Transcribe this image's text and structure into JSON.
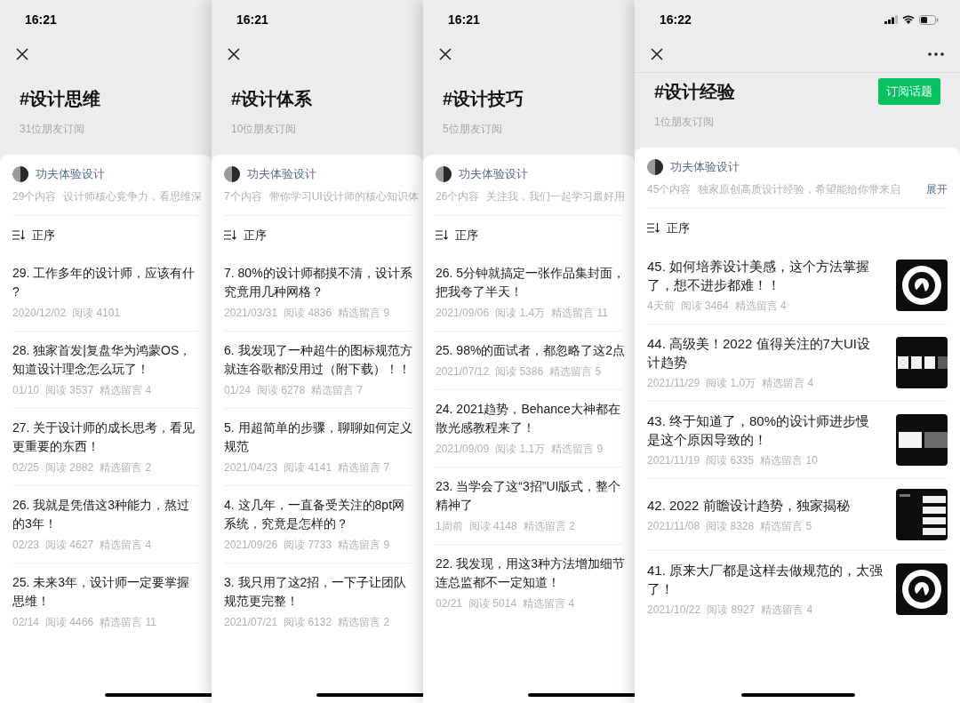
{
  "phones": [
    {
      "time": "16:21",
      "status_icons": false,
      "more_menu": false,
      "topic": "#设计思维",
      "subscribers": "31位朋友订阅",
      "author": "功夫体验设计",
      "intro": [
        "29个内容",
        "设计师核心竞争力，看思维深"
      ],
      "sort": "正序",
      "items": [
        {
          "title_lines": [
            "29. 工作多年的设计师，应该有什",
            "?"
          ],
          "meta": [
            "2020/12/02",
            "阅读 4101"
          ]
        },
        {
          "title_lines": [
            "28. 独家首发|复盘华为鸿蒙OS，",
            "知道设计理念怎么玩了！"
          ],
          "meta": [
            "01/10",
            "阅读 3537",
            "精选留言 4"
          ]
        },
        {
          "title_lines": [
            "27. 关于设计师的成长思考，看见",
            "更重要的东西！"
          ],
          "meta": [
            "02/25",
            "阅读 2882",
            "精选留言 2"
          ]
        },
        {
          "title_lines": [
            "26. 我就是凭借这3种能力，熬过",
            "的3年！"
          ],
          "meta": [
            "02/23",
            "阅读 4627",
            "精选留言 4"
          ]
        },
        {
          "title_lines": [
            "25. 未来3年，设计师一定要掌握",
            "思维！"
          ],
          "meta": [
            "02/14",
            "阅读 4466",
            "精选留言 11"
          ]
        }
      ]
    },
    {
      "time": "16:21",
      "status_icons": false,
      "more_menu": false,
      "topic": "#设计体系",
      "subscribers": "10位朋友订阅",
      "author": "功夫体验设计",
      "intro": [
        "7个内容",
        "带你学习UI设计师的核心知识体"
      ],
      "sort": "正序",
      "items": [
        {
          "title_lines": [
            "7. 80%的设计师都摸不清，设计系",
            "究竟用几种网格？"
          ],
          "meta": [
            "2021/03/31",
            "阅读 4836",
            "精选留言 9"
          ]
        },
        {
          "title_lines": [
            "6. 我发现了一种超牛的图标规范方",
            "就连谷歌都没用过（附下载）！！"
          ],
          "meta": [
            "01/24",
            "阅读 6278",
            "精选留言 7"
          ]
        },
        {
          "title_lines": [
            "5. 用超简单的步骤，聊聊如何定义",
            "规范"
          ],
          "meta": [
            "2021/04/23",
            "阅读 4141",
            "精选留言 7"
          ]
        },
        {
          "title_lines": [
            "4. 这几年，一直备受关注的8pt网",
            "系统，究竟是怎样的？"
          ],
          "meta": [
            "2021/09/26",
            "阅读 7733",
            "精选留言 9"
          ]
        },
        {
          "title_lines": [
            "3. 我只用了这2招，一下子让团队",
            "规范更完整！"
          ],
          "meta": [
            "2021/07/21",
            "阅读 6132",
            "精选留言 2"
          ]
        }
      ]
    },
    {
      "time": "16:21",
      "status_icons": false,
      "more_menu": false,
      "topic": "#设计技巧",
      "subscribers": "5位朋友订阅",
      "author": "功夫体验设计",
      "intro": [
        "26个内容",
        "关注我，我们一起学习最好用"
      ],
      "sort": "正序",
      "items": [
        {
          "title_lines": [
            "26. 5分钟就搞定一张作品集封面，",
            "把我夸了半天！"
          ],
          "meta": [
            "2021/09/06",
            "阅读 1.4万",
            "精选留言 11"
          ]
        },
        {
          "title_lines": [
            "25. 98%的面试者，都忽略了这2点"
          ],
          "meta": [
            "2021/07/12",
            "阅读 5386",
            "精选留言 5"
          ]
        },
        {
          "title_lines": [
            "24. 2021趋势，Behance大神都在",
            "散光感教程来了！"
          ],
          "meta": [
            "2021/09/09",
            "阅读 1.1万",
            "精选留言 9"
          ]
        },
        {
          "title_lines": [
            "23. 当学会了这“3招”UI版式，整个",
            "精神了"
          ],
          "meta": [
            "1周前",
            "阅读 4148",
            "精选留言 2"
          ]
        },
        {
          "title_lines": [
            "22. 我发现，用这3种方法增加细节",
            "连总监都不一定知道！"
          ],
          "meta": [
            "02/21",
            "阅读 5014",
            "精选留言 4"
          ]
        }
      ]
    },
    {
      "time": "16:22",
      "status_icons": true,
      "more_menu": true,
      "topic": "#设计经验",
      "subscribe_button": "订阅话题",
      "subscribers": "1位朋友订阅",
      "author": "功夫体验设计",
      "intro": [
        "45个内容",
        "独家原创高质设计经验，希望能给你带来启"
      ],
      "expand_link": "展开",
      "sort": "正序",
      "items": [
        {
          "title_lines": [
            "45. 如何培养设计美感，这个方法掌握",
            "了，想不进步都难！！"
          ],
          "meta": [
            "4天前",
            "阅读 3464",
            "精选留言 4"
          ],
          "thumbnail": {
            "kind": "picture"
          }
        },
        {
          "title_lines": [
            "44. 高级美！2022 值得关注的7大UI设",
            "计趋势"
          ],
          "meta": [
            "2021/11/29",
            "阅读 1.0万",
            "精选留言 4"
          ],
          "thumbnail": {
            "kind": "picture"
          }
        },
        {
          "title_lines": [
            "43. 终于知道了，80%的设计师进步慢",
            "是这个原因导致的！"
          ],
          "meta": [
            "2021/11/19",
            "阅读 6335",
            "精选留言 10"
          ],
          "thumbnail": {
            "kind": "picture"
          }
        },
        {
          "title_lines": [
            "42. 2022 前瞻设计趋势，独家揭秘"
          ],
          "meta": [
            "2021/11/08",
            "阅读 8328",
            "精选留言 5"
          ],
          "thumbnail": {
            "kind": "picture"
          }
        },
        {
          "title_lines": [
            "41. 原来大厂都是这样去做规范的，太强",
            "了！"
          ],
          "meta": [
            "2021/10/22",
            "阅读 8927",
            "精选留言 4"
          ],
          "thumbnail": {
            "kind": "picture"
          }
        }
      ]
    }
  ]
}
